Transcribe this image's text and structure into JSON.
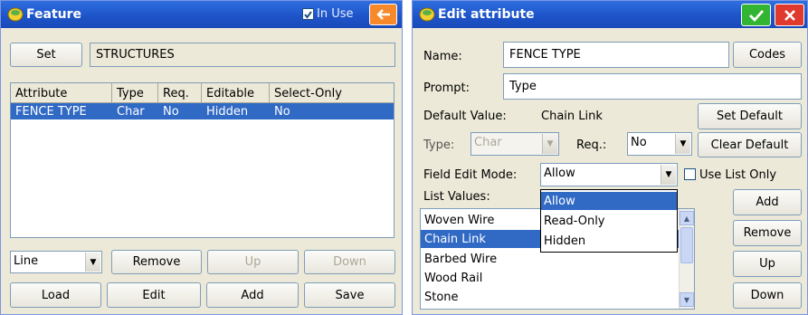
{
  "feature": {
    "title": "Feature",
    "in_use_label": "In Use",
    "in_use_checked": true,
    "back_icon": "arrow-left-icon",
    "set_label": "Set",
    "feature_name": "STRUCTURES",
    "columns": [
      "Attribute",
      "Type",
      "Req.",
      "Editable",
      "Select-Only"
    ],
    "rows": [
      [
        "FENCE TYPE",
        "Char",
        "No",
        "Hidden",
        "No"
      ]
    ],
    "type_select": "Line",
    "remove_label": "Remove",
    "up_label": "Up",
    "down_label": "Down",
    "load_label": "Load",
    "edit_label": "Edit",
    "add_label": "Add",
    "save_label": "Save"
  },
  "edit_attribute": {
    "title": "Edit attribute",
    "ok_icon": "checkmark-icon",
    "close_icon": "close-icon",
    "name_label": "Name:",
    "name_value": "FENCE TYPE",
    "codes_label": "Codes",
    "prompt_label": "Prompt:",
    "prompt_value": "Type",
    "default_label": "Default Value:",
    "default_value": "Chain Link",
    "set_default_label": "Set Default",
    "type_label": "Type:",
    "type_value": "Char",
    "req_label": "Req.:",
    "req_value": "No",
    "clear_default_label": "Clear Default",
    "field_edit_mode_label": "Field Edit Mode:",
    "field_edit_mode_value": "Allow",
    "use_list_only_label": "Use List Only",
    "use_list_only_checked": false,
    "list_values_label": "List Values:",
    "list_values": [
      "Woven Wire",
      "Chain Link",
      "Barbed Wire",
      "Wood Rail",
      "Stone"
    ],
    "selected_index": 1,
    "add_label": "Add",
    "remove_label": "Remove",
    "up_label": "Up",
    "down_label": "Down",
    "dropdown_options": [
      "Allow",
      "Read-Only",
      "Hidden"
    ]
  },
  "colors": {
    "titlebar": "#1d52c8",
    "selection": "#316ac5",
    "ok_green": "#33b533",
    "close_red": "#e0392e",
    "back_orange": "#f7892b"
  }
}
